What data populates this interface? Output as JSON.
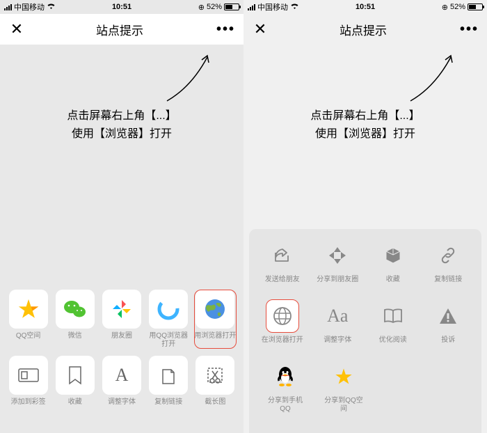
{
  "statusBar": {
    "carrier": "中国移动",
    "time": "10:51",
    "battery": "52%"
  },
  "nav": {
    "title": "站点提示"
  },
  "instruction": {
    "line1": "点击屏幕右上角【...】",
    "line2": "使用【浏览器】打开"
  },
  "left": {
    "row1": [
      {
        "name": "qqzone",
        "label": "QQ空间",
        "icon": "star-yellow"
      },
      {
        "name": "wechat",
        "label": "微信",
        "icon": "wechat"
      },
      {
        "name": "moments",
        "label": "朋友圈",
        "icon": "moments"
      },
      {
        "name": "qqbrowser",
        "label": "用QQ浏览器打开",
        "icon": "qqbrowser"
      },
      {
        "name": "browser",
        "label": "用浏览器打开",
        "icon": "globe",
        "highlight": true
      }
    ],
    "row2": [
      {
        "name": "add-bookmark",
        "label": "添加到彩签",
        "icon": "rect"
      },
      {
        "name": "favorite",
        "label": "收藏",
        "icon": "bookmark"
      },
      {
        "name": "font",
        "label": "调整字体",
        "icon": "A"
      },
      {
        "name": "copy-link",
        "label": "复制链接",
        "icon": "copy"
      },
      {
        "name": "screenshot",
        "label": "截长图",
        "icon": "cut"
      }
    ]
  },
  "right": {
    "row1": [
      {
        "name": "send-friend",
        "label": "发送给朋友",
        "icon": "share-out"
      },
      {
        "name": "share-moments",
        "label": "分享到朋友圈",
        "icon": "aperture"
      },
      {
        "name": "collect",
        "label": "收藏",
        "icon": "cube"
      },
      {
        "name": "copy-link",
        "label": "复制链接",
        "icon": "link"
      }
    ],
    "row2": [
      {
        "name": "open-browser",
        "label": "在浏览器打开",
        "icon": "globe-outline",
        "highlight": true
      },
      {
        "name": "adjust-font",
        "label": "调整字体",
        "icon": "Aa"
      },
      {
        "name": "optimize-read",
        "label": "优化阅读",
        "icon": "book"
      },
      {
        "name": "report",
        "label": "投诉",
        "icon": "warn"
      }
    ],
    "row3": [
      {
        "name": "share-qq",
        "label": "分享到手机QQ",
        "icon": "penguin"
      },
      {
        "name": "share-qqzone",
        "label": "分享到QQ空间",
        "icon": "star-yellow"
      }
    ]
  }
}
